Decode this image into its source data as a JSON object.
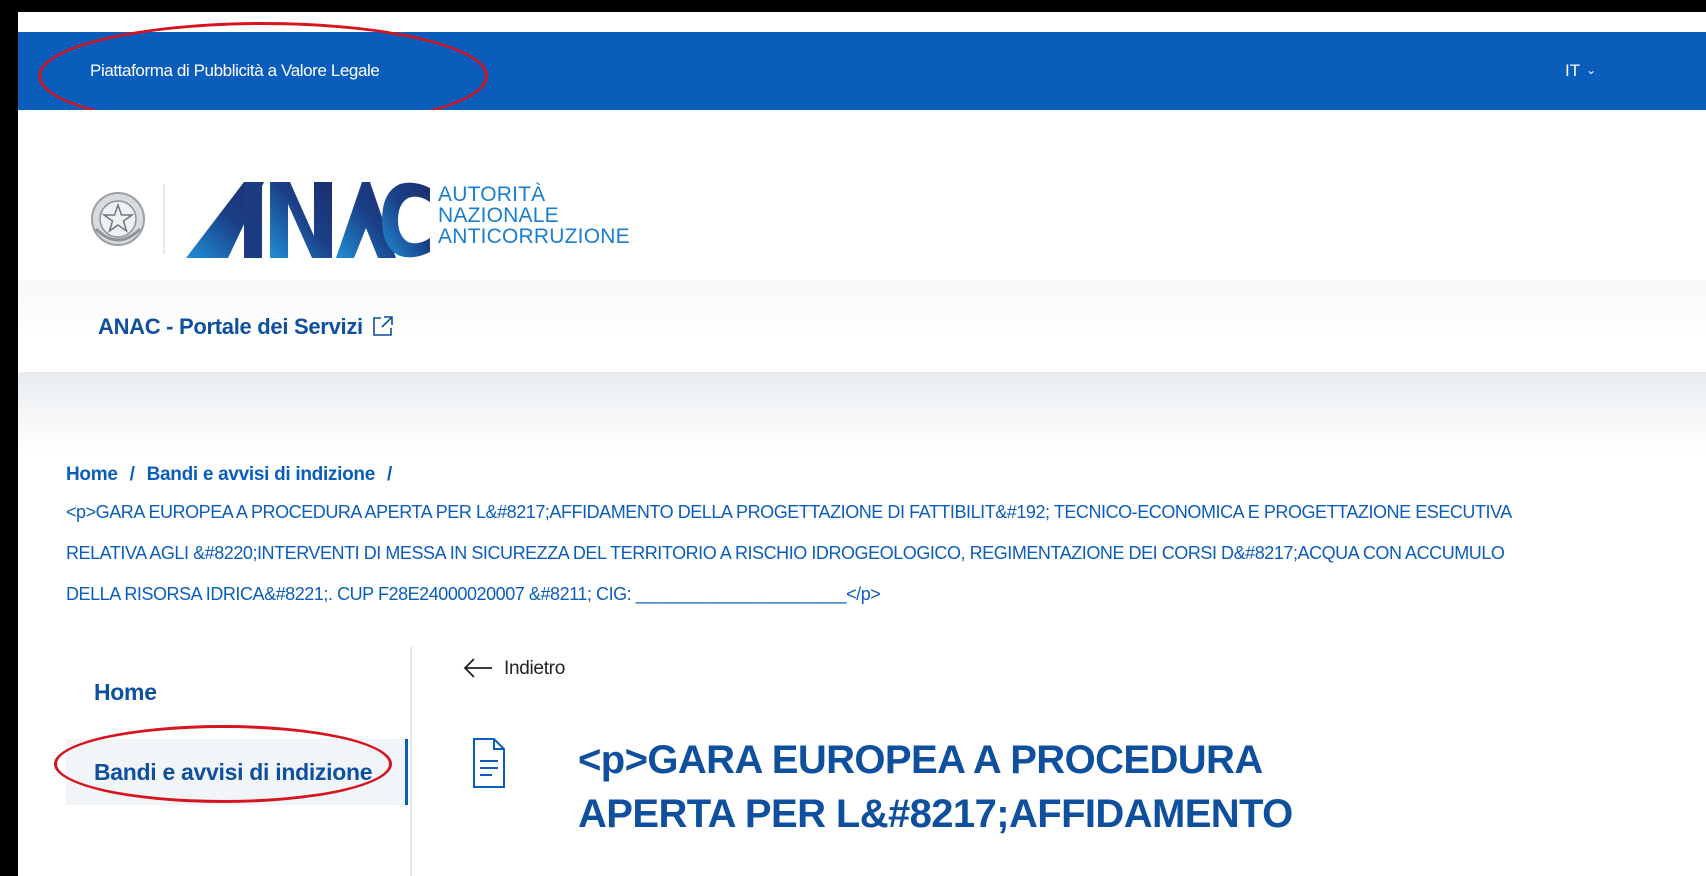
{
  "topbar": {
    "site_name": "Piattaforma di Pubblicità a Valore Legale",
    "language": "IT"
  },
  "header": {
    "logo_mark": "ANAC",
    "logo_line1": "AUTORITÀ",
    "logo_line2": "NAZIONALE",
    "logo_line3": "ANTICORRUZIONE"
  },
  "services": {
    "portal_label": "ANAC - Portale dei Servizi"
  },
  "breadcrumb": {
    "home": "Home",
    "section": "Bandi e avvisi di indizione",
    "separator": "/",
    "current": "<p>GARA EUROPEA A PROCEDURA APERTA PER L&#8217;AFFIDAMENTO DELLA PROGETTAZIONE DI FATTIBILIT&#192; TECNICO-ECONOMICA E PROGETTAZIONE ESECUTIVA RELATIVA AGLI &#8220;INTERVENTI DI MESSA IN SICUREZZA DEL TERRITORIO A RISCHIO IDROGEOLOGICO, REGIMENTAZIONE DEI CORSI D&#8217;ACQUA CON ACCUMULO DELLA RISORSA IDRICA&#8221;. CUP F28E24000020007 &#8211; CIG: ______________________</p>"
  },
  "sidebar": {
    "items": [
      {
        "label": "Home"
      },
      {
        "label": "Bandi e avvisi di indizione"
      }
    ]
  },
  "main": {
    "back_label": "Indietro",
    "title": "<p>GARA EUROPEA A PROCEDURA APERTA PER L&#8217;AFFIDAMENTO"
  },
  "colors": {
    "brand_blue": "#0b5dbb",
    "link_blue": "#0e4f9e",
    "logo_cyan": "#1a7ed0",
    "highlight_red": "#d6141f"
  },
  "icons": [
    "chevron-down-icon",
    "external-link-icon",
    "arrow-left-icon",
    "document-icon",
    "emblem-icon"
  ]
}
